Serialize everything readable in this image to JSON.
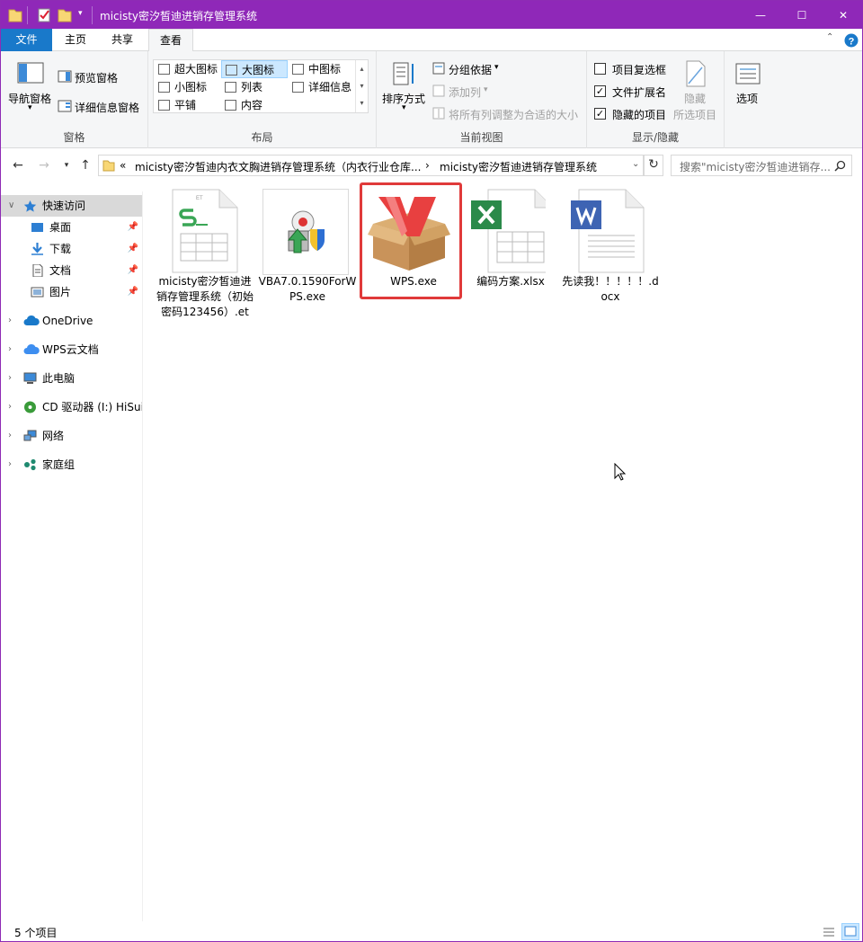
{
  "window": {
    "title": "micisty密汐皙迪进销存管理系统",
    "accent": "#8f28b8",
    "controls": {
      "minimize": "—",
      "maximize": "☐",
      "close": "✕"
    }
  },
  "tabs": [
    {
      "label": "文件"
    },
    {
      "label": "主页"
    },
    {
      "label": "共享"
    },
    {
      "label": "查看"
    }
  ],
  "ribbon": {
    "pane_group": {
      "nav_pane": "导航窗格",
      "preview_pane": "预览窗格",
      "details_pane": "详细信息窗格",
      "label": "窗格"
    },
    "layout_group": {
      "items": [
        "超大图标",
        "大图标",
        "中图标",
        "小图标",
        "列表",
        "详细信息",
        "平铺",
        "内容"
      ],
      "selected": "大图标",
      "label": "布局"
    },
    "view_group": {
      "sort_by": "排序方式",
      "group_by": "分组依据",
      "add_columns": "添加列",
      "fit_columns": "将所有列调整为合适的大小",
      "label": "当前视图"
    },
    "showhide_group": {
      "item_checkboxes": {
        "label": "项目复选框",
        "checked": false
      },
      "file_extensions": {
        "label": "文件扩展名",
        "checked": true
      },
      "hidden_items": {
        "label": "隐藏的项目",
        "checked": true
      },
      "hide_selected": "隐藏",
      "selected_items": "所选项目",
      "label": "显示/隐藏"
    },
    "options": "选项"
  },
  "address": {
    "prefix": "«",
    "segment1": "micisty密汐皙迪内衣文胸进销存管理系统（内衣行业仓库...",
    "segment2": "micisty密汐皙迪进销存管理系统",
    "sep": "›",
    "search_placeholder": "搜索\"micisty密汐皙迪进销存..."
  },
  "navpane": {
    "items": [
      {
        "label": "快速访问",
        "selected": true
      },
      {
        "label": "桌面",
        "pinned": true
      },
      {
        "label": "下载",
        "pinned": true
      },
      {
        "label": "文档",
        "pinned": true
      },
      {
        "label": "图片",
        "pinned": true
      },
      {
        "label": "OneDrive"
      },
      {
        "label": "WPS云文档"
      },
      {
        "label": "此电脑"
      },
      {
        "label": "CD 驱动器 (I:) HiSuite"
      },
      {
        "label": "网络"
      },
      {
        "label": "家庭组"
      }
    ]
  },
  "files": [
    {
      "name": "micisty密汐皙迪进销存管理系统（初始密码123456）.et",
      "icon": "wps-spreadsheet-icon"
    },
    {
      "name": "VBA7.0.1590ForWPS.exe",
      "icon": "installer-icon"
    },
    {
      "name": "WPS.exe",
      "icon": "wps-package-icon",
      "selected": true
    },
    {
      "name": "编码方案.xlsx",
      "icon": "excel-icon"
    },
    {
      "name": "先读我！！！！！.docx",
      "icon": "word-icon"
    }
  ],
  "status": {
    "count": "5 个项目"
  }
}
